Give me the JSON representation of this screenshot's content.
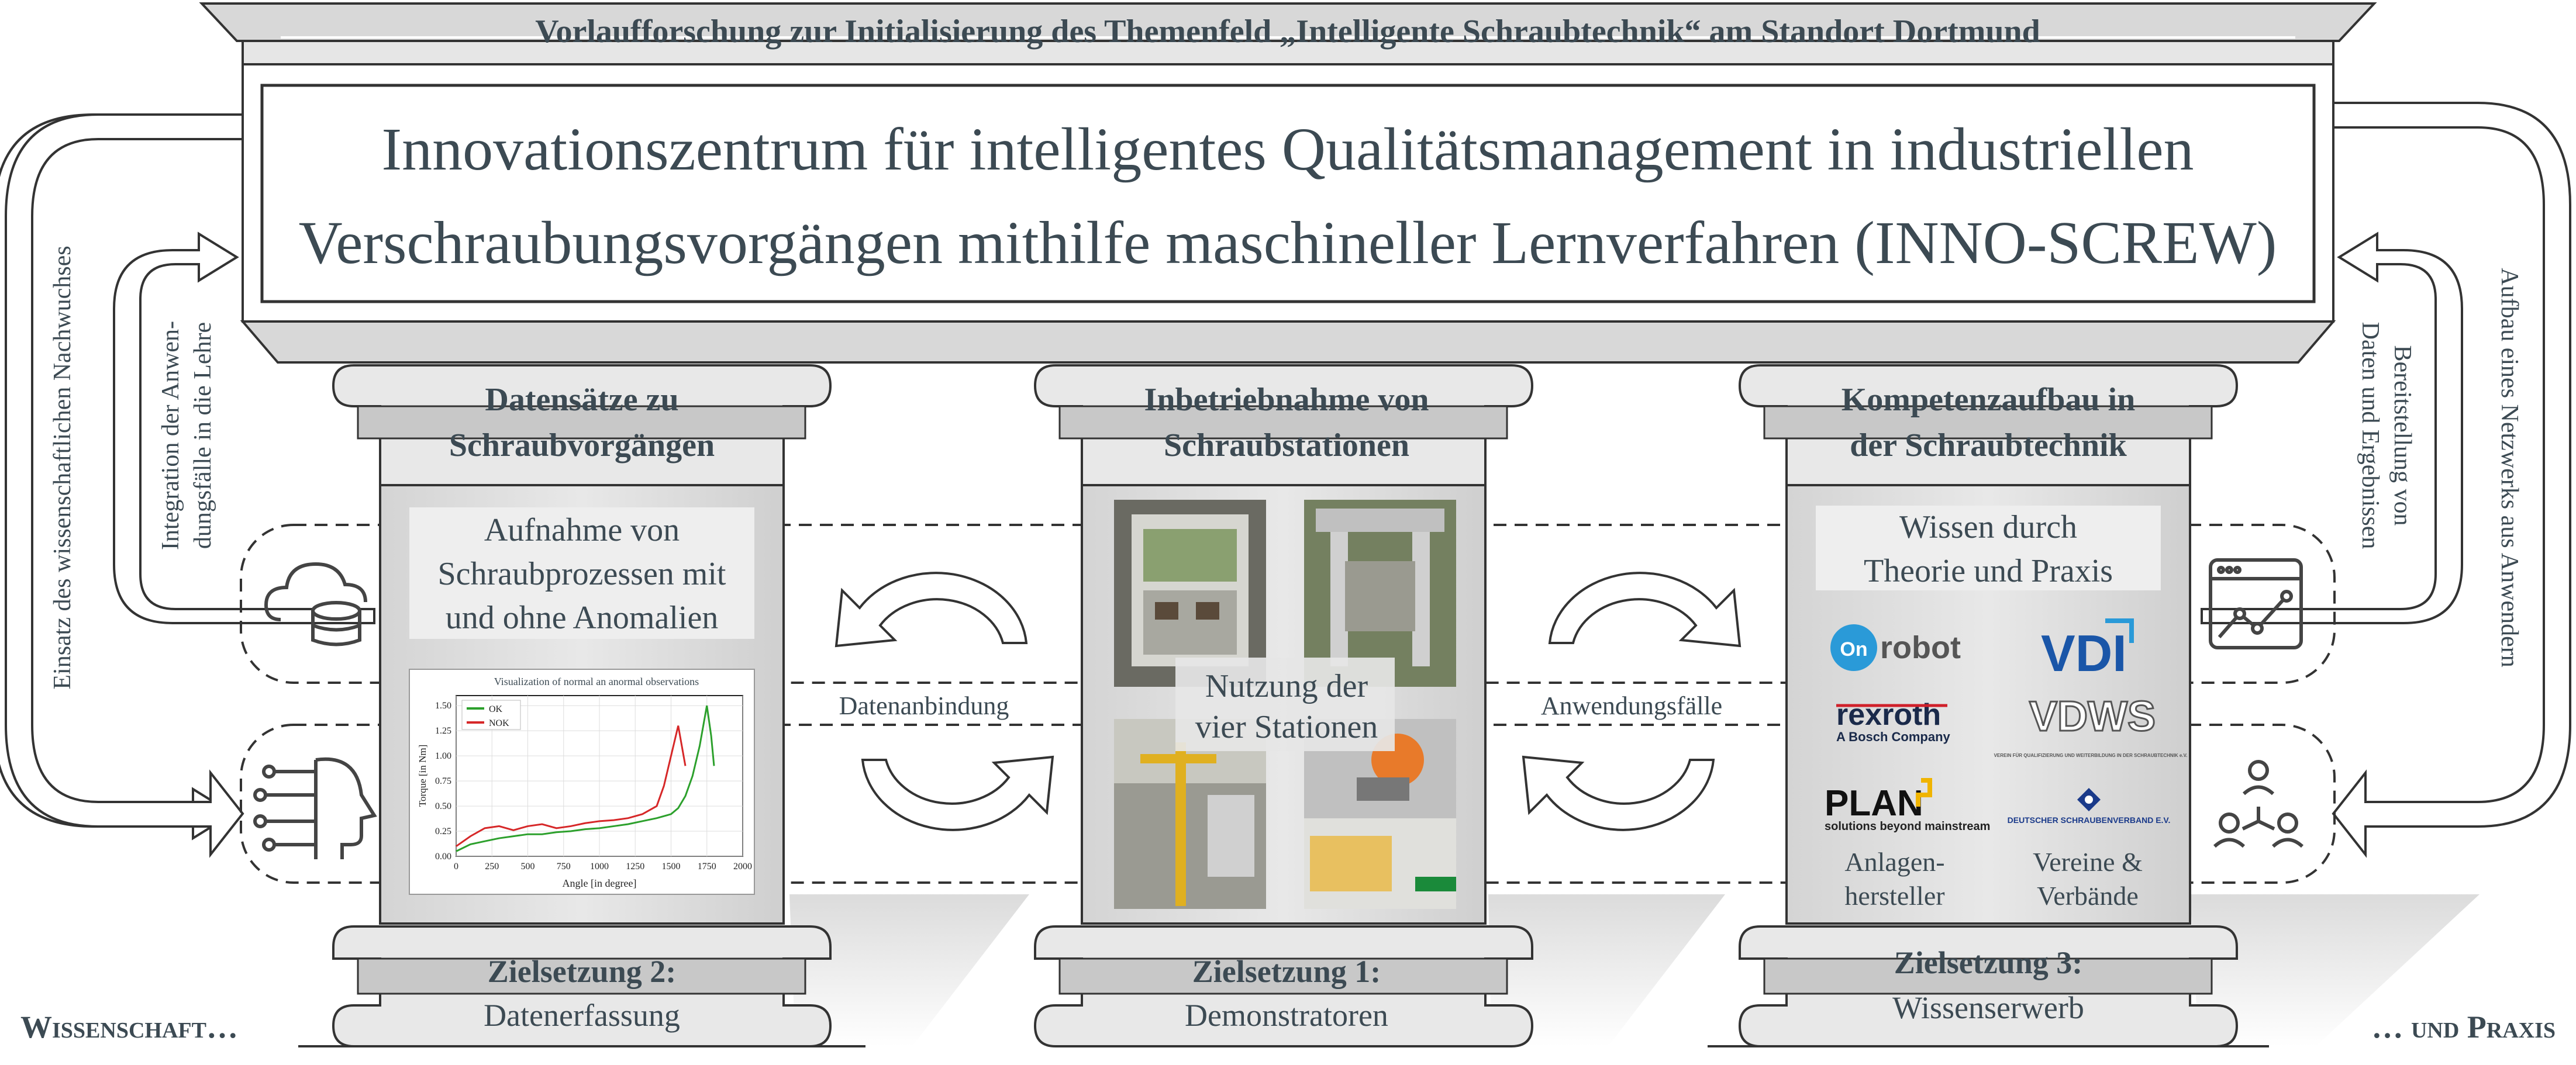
{
  "header": {
    "title": "Vorlaufforschung zur Initialisierung des Themenfeld „Intelligente Schraubtechnik“ am Standort Dortmund",
    "main_line1": "Innovationszentrum für intelligentes Qualitätsmanagement in industriellen",
    "main_line2": "Verschraubungsvorgängen mithilfe maschineller Lernverfahren (INNO-SCREW)"
  },
  "pillars": {
    "left": {
      "cap_line1": "Datensätze zu",
      "cap_line2": "Schraubvorgängen",
      "box_line1": "Aufnahme von",
      "box_line2": "Schraubprozessen mit",
      "box_line3": "und ohne Anomalien",
      "base_title": "Zielsetzung 2:",
      "base_sub": "Datenerfassung"
    },
    "center": {
      "cap_line1": "Inbetriebnahme von",
      "cap_line2": "Schraubstationen",
      "overlay_line1": "Nutzung der",
      "overlay_line2": "vier Stationen",
      "base_title": "Zielsetzung 1:",
      "base_sub": "Demonstratoren"
    },
    "right": {
      "cap_line1": "Kompetenzaufbau in",
      "cap_line2": "der Schraubtechnik",
      "box_line1": "Wissen durch",
      "box_line2": "Theorie und Praxis",
      "col1_line1": "Anlagen-",
      "col1_line2": "hersteller",
      "col2_line1": "Vereine &",
      "col2_line2": "Verbände",
      "base_title": "Zielsetzung 3:",
      "base_sub": "Wissenserwerb"
    }
  },
  "logos": {
    "onrobot": "robot",
    "onrobot_mark": "On",
    "vdi": "VDI",
    "rexroth": "rexroth",
    "rexroth_sub": "A Bosch Company",
    "vdws": "VDWS",
    "vdws_sub": "VEREIN FÜR QUALIFIZIERUNG UND WEITERBILDUNG IN DER SCHRAUBTECHNIK e.V.",
    "plan": "PLAN",
    "plan_sub": "solutions beyond mainstream",
    "dsv": "DEUTSCHER SCHRAUBENVERBAND E.V."
  },
  "side_labels": {
    "outer_left": "Einsatz des wissenschaftlichen Nachwuchses",
    "inner_left_line1": "Integration der Anwen-",
    "inner_left_line2": "dungsfälle in die Lehre",
    "outer_right": "Aufbau eines Netzwerks aus Anwendern",
    "inner_right_line1": "Bereitstellung von",
    "inner_right_line2": "Daten und Ergebnissen"
  },
  "connectors": {
    "left": "Datenanbindung",
    "right": "Anwendungsfälle"
  },
  "footer": {
    "left": "Wissenschaft…",
    "right": "… und Praxis"
  },
  "chart_data": {
    "type": "line",
    "title": "Visualization of normal an anormal observations",
    "xlabel": "Angle [in degree]",
    "ylabel": "Torque [in Nm]",
    "xlim": [
      0,
      2000
    ],
    "ylim": [
      0,
      1.6
    ],
    "xticks": [
      0,
      250,
      500,
      750,
      1000,
      1250,
      1500,
      1750,
      2000
    ],
    "yticks": [
      0.0,
      0.25,
      0.5,
      0.75,
      1.0,
      1.25,
      1.5
    ],
    "legend_position": "top-left",
    "series": [
      {
        "name": "OK",
        "color": "#2ca02c",
        "x": [
          0,
          100,
          200,
          300,
          400,
          500,
          600,
          700,
          800,
          900,
          1000,
          1100,
          1200,
          1300,
          1400,
          1500,
          1550,
          1600,
          1650,
          1700,
          1750,
          1780,
          1800
        ],
        "y": [
          0.05,
          0.12,
          0.15,
          0.18,
          0.2,
          0.22,
          0.22,
          0.24,
          0.25,
          0.27,
          0.28,
          0.3,
          0.32,
          0.35,
          0.38,
          0.42,
          0.48,
          0.6,
          0.8,
          1.1,
          1.5,
          1.2,
          0.9
        ]
      },
      {
        "name": "NOK",
        "color": "#d62728",
        "x": [
          0,
          100,
          200,
          300,
          400,
          500,
          600,
          700,
          800,
          900,
          1000,
          1100,
          1200,
          1300,
          1400,
          1450,
          1500,
          1550,
          1600
        ],
        "y": [
          0.1,
          0.2,
          0.28,
          0.3,
          0.26,
          0.3,
          0.32,
          0.28,
          0.3,
          0.33,
          0.35,
          0.36,
          0.38,
          0.42,
          0.5,
          0.7,
          1.0,
          1.3,
          0.9
        ]
      }
    ]
  }
}
